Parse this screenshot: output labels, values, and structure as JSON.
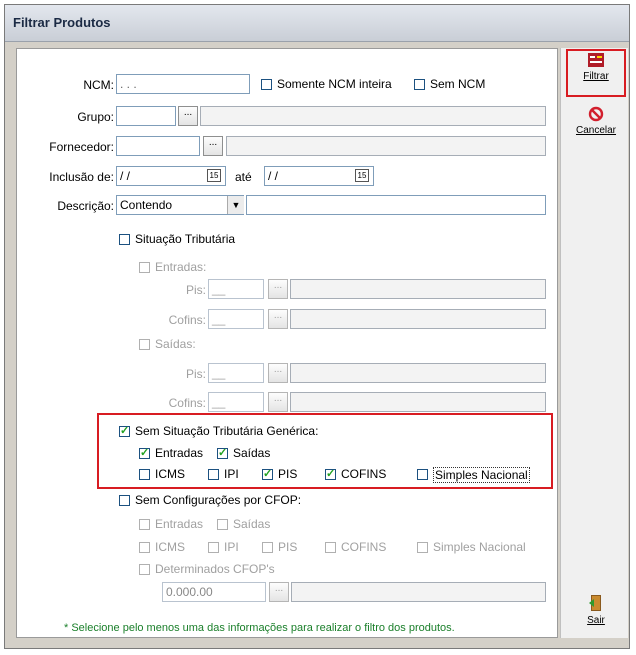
{
  "window": {
    "title": "Filtrar Produtos"
  },
  "colors": {
    "highlight": "#d81c22",
    "accent_green": "#21a121"
  },
  "form": {
    "ncm": {
      "label": "NCM:",
      "value": ". . ."
    },
    "somente_ncm_inteira": {
      "label": "Somente NCM inteira",
      "checked": false
    },
    "sem_ncm": {
      "label": "Sem NCM",
      "checked": false
    },
    "grupo": {
      "label": "Grupo:",
      "value": ""
    },
    "fornecedor": {
      "label": "Fornecedor:",
      "value": ""
    },
    "inclusao": {
      "label": "Inclusão de:",
      "from": "/ /",
      "until_label": "até",
      "to": "/ /"
    },
    "descricao": {
      "label": "Descrição:",
      "mode": "Contendo",
      "value": ""
    },
    "lookup_button": "...",
    "calendar_glyph": "15"
  },
  "situacao_tributaria": {
    "label": "Situação Tributária",
    "entradas": {
      "label": "Entradas:",
      "pis_label": "Pis:",
      "cofins_label": "Cofins:"
    },
    "saidas": {
      "label": "Saídas:",
      "pis_label": "Pis:",
      "cofins_label": "Cofins:"
    }
  },
  "sem_situacao_generica": {
    "label": "Sem Situação Tributária Genérica:",
    "checked": true,
    "entradas": {
      "label": "Entradas",
      "checked": true
    },
    "saidas": {
      "label": "Saídas",
      "checked": true
    },
    "icms": {
      "label": "ICMS",
      "checked": false
    },
    "ipi": {
      "label": "IPI",
      "checked": false
    },
    "pis": {
      "label": "PIS",
      "checked": true
    },
    "cofins": {
      "label": "COFINS",
      "checked": true
    },
    "simples": {
      "label": "Simples Nacional",
      "checked": false
    }
  },
  "sem_config_cfop": {
    "label": "Sem Configurações por CFOP:",
    "entradas": "Entradas",
    "saidas": "Saídas",
    "icms": "ICMS",
    "ipi": "IPI",
    "pis": "PIS",
    "cofins": "COFINS",
    "simples": "Simples Nacional",
    "determinados": "Determinados CFOP's",
    "cfop_value": "0.000.00"
  },
  "note": "* Selecione pelo menos uma das informações para realizar o filtro dos produtos.",
  "sidebar": {
    "filtrar": "Filtrar",
    "cancelar": "Cancelar",
    "sair": "Sair"
  }
}
